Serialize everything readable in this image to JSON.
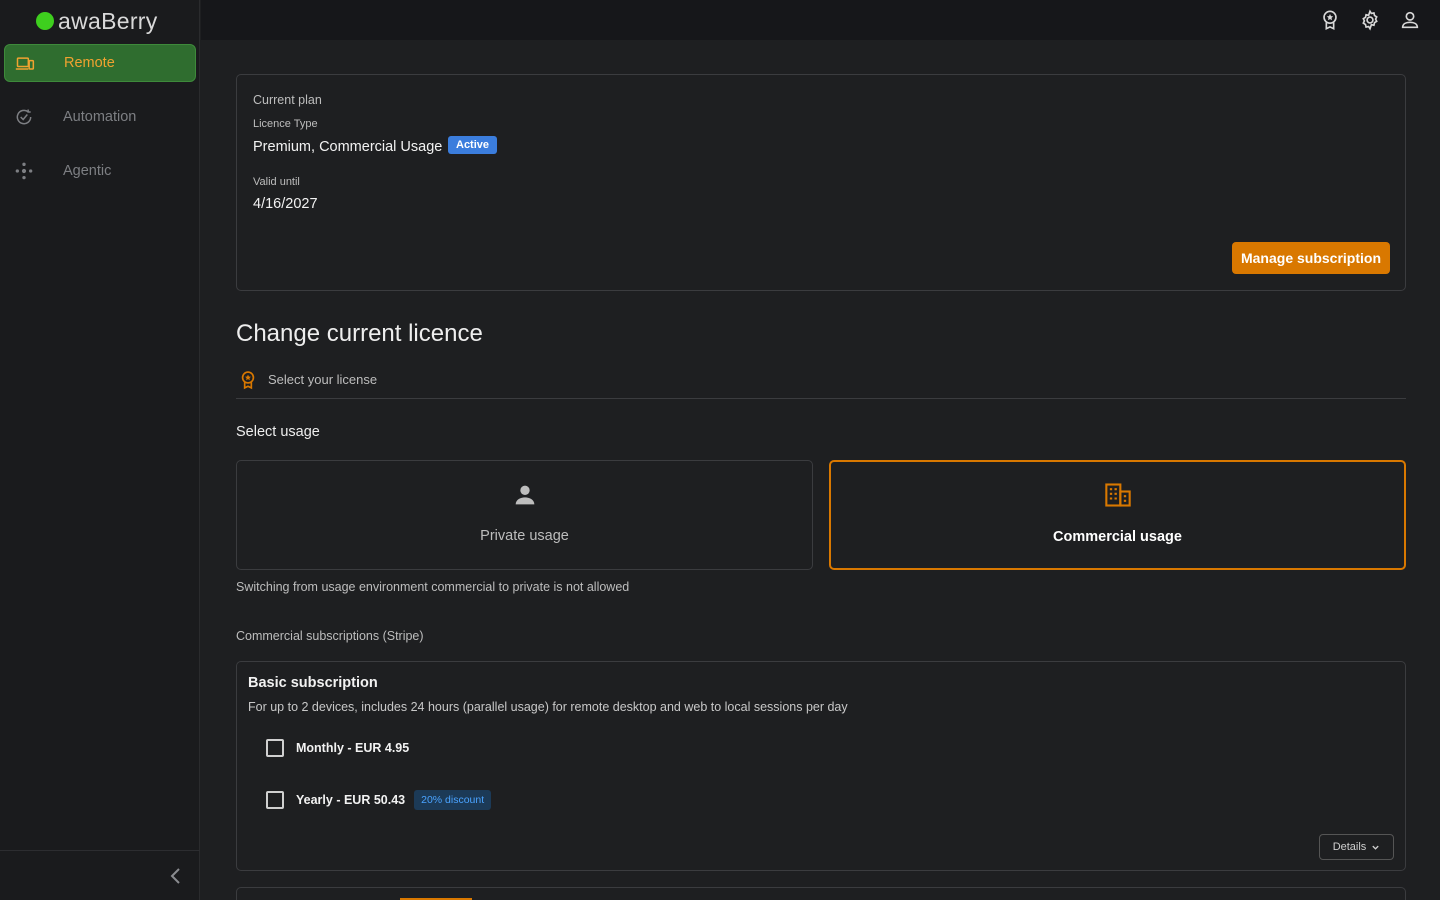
{
  "app": {
    "brand": "awaBerry"
  },
  "sidebar": {
    "items": [
      {
        "label": "Remote",
        "icon": "devices-icon",
        "active": true
      },
      {
        "label": "Automation",
        "icon": "automation-icon",
        "active": false
      },
      {
        "label": "Agentic",
        "icon": "agentic-icon",
        "active": false
      }
    ]
  },
  "topbar": {
    "icons": [
      "award-icon",
      "gear-icon",
      "user-icon"
    ]
  },
  "current_plan": {
    "heading": "Current plan",
    "licence_type_label": "Licence Type",
    "licence_type": "Premium, Commercial Usage",
    "status": "Active",
    "valid_until_label": "Valid until",
    "valid_until": "4/16/2027",
    "manage_button": "Manage subscription"
  },
  "change_licence": {
    "title": "Change current licence",
    "step_label": "Select your license",
    "select_usage": "Select usage",
    "private_label": "Private usage",
    "commercial_label": "Commercial usage",
    "switch_note": "Switching from usage environment commercial to private is not allowed",
    "subscriptions_heading": "Commercial subscriptions (Stripe)"
  },
  "basic_subscription": {
    "title": "Basic subscription",
    "description": "For up to 2 devices, includes 24 hours (parallel usage) for remote desktop and web to local sessions per day",
    "monthly": "Monthly - EUR 4.95",
    "yearly": "Yearly - EUR 50.43",
    "discount": "20% discount",
    "details": "Details"
  },
  "colors": {
    "accent": "#d97800",
    "active_nav": "#2f6d2f",
    "badge": "#3b7ddd",
    "brand_dot": "#3ecf1e"
  }
}
